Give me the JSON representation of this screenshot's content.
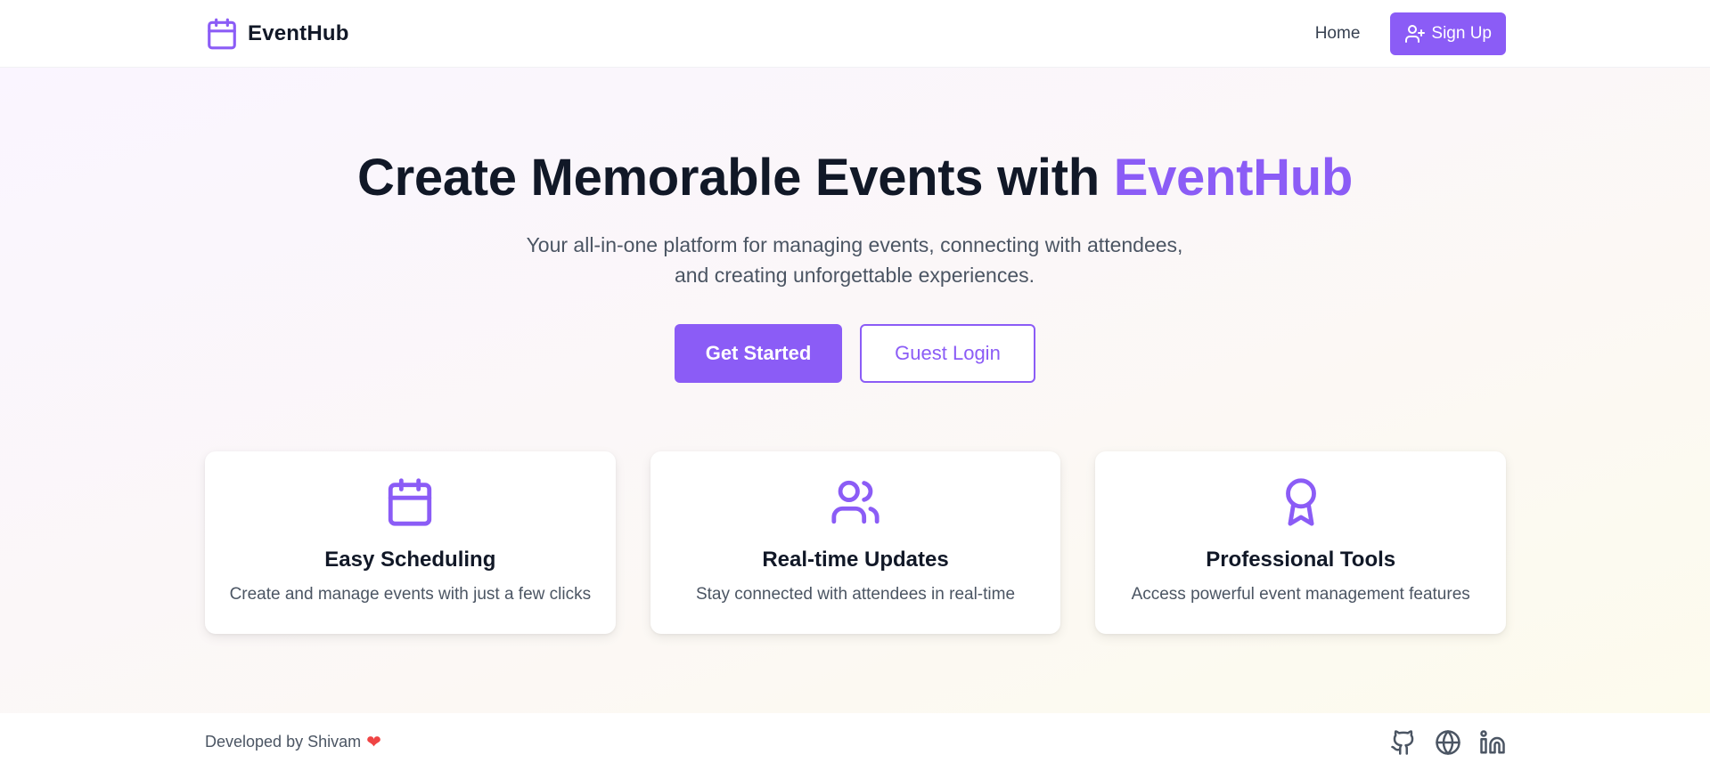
{
  "nav": {
    "brand_name": "EventHub",
    "brand_icon": "calendar-icon",
    "home_label": "Home",
    "signup_label": "Sign Up",
    "signup_icon": "user-plus-icon"
  },
  "hero": {
    "title_prefix": "Create Memorable Events with",
    "title_accent": "EventHub",
    "subtitle_line1": "Your all-in-one platform for managing events, connecting with attendees,",
    "subtitle_line2": "and creating unforgettable experiences.",
    "primary_cta": "Get Started",
    "secondary_cta": "Guest Login"
  },
  "features": [
    {
      "icon": "calendar-icon",
      "title": "Easy Scheduling",
      "description": "Create and manage events with just a few clicks"
    },
    {
      "icon": "users-icon",
      "title": "Real-time Updates",
      "description": "Stay connected with attendees in real-time"
    },
    {
      "icon": "award-icon",
      "title": "Professional Tools",
      "description": "Access powerful event management features"
    }
  ],
  "footer": {
    "credit": "Developed by Shivam",
    "heart": "❤",
    "links": [
      {
        "icon": "github-icon"
      },
      {
        "icon": "globe-icon"
      },
      {
        "icon": "linkedin-icon"
      }
    ]
  },
  "colors": {
    "accent": "#8b5cf6",
    "heading": "#111827",
    "body_text": "#4b5563",
    "heart": "#ef4444"
  }
}
